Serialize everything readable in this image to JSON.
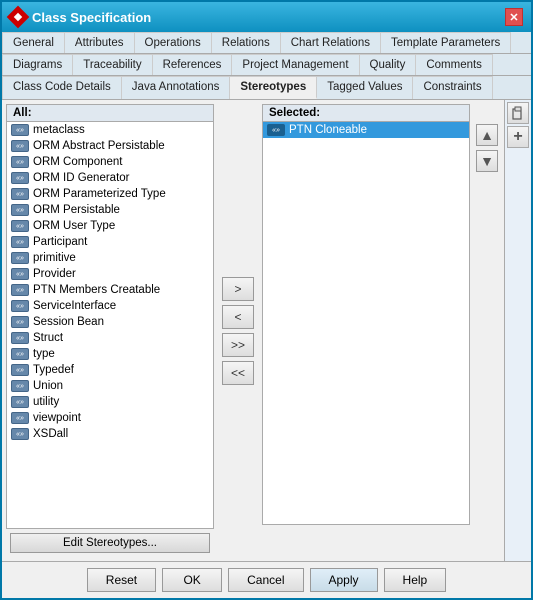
{
  "window": {
    "title": "Class Specification"
  },
  "tabs_row1": {
    "tabs": [
      {
        "label": "General",
        "active": false
      },
      {
        "label": "Attributes",
        "active": false
      },
      {
        "label": "Operations",
        "active": false
      },
      {
        "label": "Relations",
        "active": false
      },
      {
        "label": "Chart Relations",
        "active": false
      },
      {
        "label": "Template Parameters",
        "active": false
      }
    ]
  },
  "tabs_row2": {
    "tabs": [
      {
        "label": "Diagrams",
        "active": false
      },
      {
        "label": "Traceability",
        "active": false
      },
      {
        "label": "References",
        "active": false
      },
      {
        "label": "Project Management",
        "active": false
      },
      {
        "label": "Quality",
        "active": false
      },
      {
        "label": "Comments",
        "active": false
      }
    ]
  },
  "tabs_row3": {
    "tabs": [
      {
        "label": "Class Code Details",
        "active": false
      },
      {
        "label": "Java Annotations",
        "active": false
      },
      {
        "label": "Stereotypes",
        "active": true
      },
      {
        "label": "Tagged Values",
        "active": false
      },
      {
        "label": "Constraints",
        "active": false
      }
    ]
  },
  "all_panel": {
    "label": "All:",
    "items": [
      {
        "text": "metaclass"
      },
      {
        "text": "ORM Abstract Persistable"
      },
      {
        "text": "ORM Component"
      },
      {
        "text": "ORM ID Generator"
      },
      {
        "text": "ORM Parameterized Type"
      },
      {
        "text": "ORM Persistable"
      },
      {
        "text": "ORM User Type"
      },
      {
        "text": "Participant"
      },
      {
        "text": "primitive"
      },
      {
        "text": "Provider"
      },
      {
        "text": "PTN Members Creatable"
      },
      {
        "text": "ServiceInterface"
      },
      {
        "text": "Session Bean"
      },
      {
        "text": "Struct"
      },
      {
        "text": "type"
      },
      {
        "text": "Typedef"
      },
      {
        "text": "Union"
      },
      {
        "text": "utility"
      },
      {
        "text": "viewpoint"
      },
      {
        "text": "XSDall"
      }
    ]
  },
  "selected_panel": {
    "label": "Selected:",
    "items": [
      {
        "text": "PTN Cloneable",
        "selected": true
      }
    ]
  },
  "buttons": {
    "move_right": ">",
    "move_left": "<",
    "move_all_right": ">>",
    "move_all_left": "<<",
    "up": "▲",
    "down": "▼"
  },
  "bottom_buttons": {
    "reset": "Reset",
    "ok": "OK",
    "cancel": "Cancel",
    "apply": "Apply",
    "help": "Help"
  },
  "edit_stereotypes": "Edit Stereotypes...",
  "toolbar": {
    "add_icon": "+",
    "paste_icon": "⧉",
    "link_icon": "↗"
  }
}
